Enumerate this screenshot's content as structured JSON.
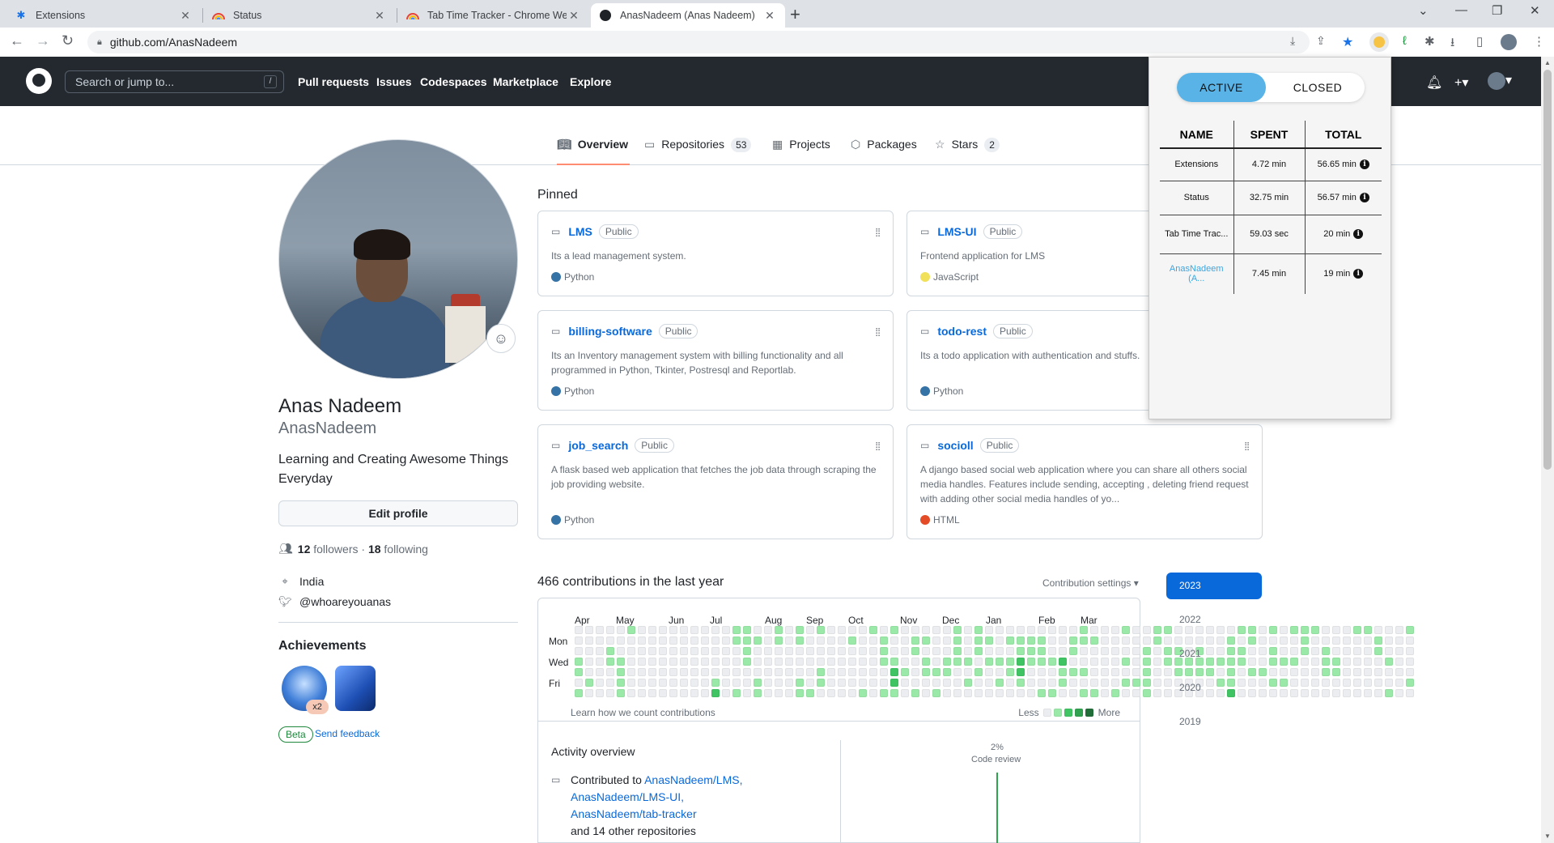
{
  "browser": {
    "tabs": [
      {
        "title": "Extensions",
        "icon": "puzzle-icon"
      },
      {
        "title": "Status",
        "icon": "rainbow-icon"
      },
      {
        "title": "Tab Time Tracker - Chrome Web",
        "icon": "rainbow-icon"
      },
      {
        "title": "AnasNadeem (Anas Nadeem)",
        "icon": "github-icon"
      }
    ],
    "url": "github.com/AnasNadeem"
  },
  "gh_header": {
    "search_placeholder": "Search or jump to...",
    "slash": "/",
    "nav": [
      "Pull requests",
      "Issues",
      "Codespaces",
      "Marketplace",
      "Explore"
    ]
  },
  "profile": {
    "name": "Anas Nadeem",
    "login": "AnasNadeem",
    "bio": "Learning and Creating Awesome Things Everyday",
    "edit_label": "Edit profile",
    "followers": "12",
    "followers_label": "followers",
    "dot": "·",
    "following": "18",
    "following_label": "following",
    "location": "India",
    "twitter": "@whoareyouanas",
    "achievements_title": "Achievements",
    "badge_count": "x2",
    "beta": "Beta",
    "feedback": "Send feedback"
  },
  "profile_tabs": [
    {
      "label": "Overview",
      "count": null
    },
    {
      "label": "Repositories",
      "count": "53"
    },
    {
      "label": "Projects",
      "count": null
    },
    {
      "label": "Packages",
      "count": null
    },
    {
      "label": "Stars",
      "count": "2"
    }
  ],
  "pinned": {
    "title": "Pinned",
    "public_label": "Public",
    "repos": [
      {
        "name": "LMS",
        "desc": "Its a lead management system.",
        "lang": "Python",
        "color": "#3572A5"
      },
      {
        "name": "LMS-UI",
        "desc": "Frontend application for LMS",
        "lang": "JavaScript",
        "color": "#f1e05a"
      },
      {
        "name": "billing-software",
        "desc": "Its an Inventory management system with billing functionality and all programmed in Python, Tkinter, Postresql and Reportlab.",
        "lang": "Python",
        "color": "#3572A5"
      },
      {
        "name": "todo-rest",
        "desc": "Its a todo application with authentication and stuffs.",
        "lang": "Python",
        "color": "#3572A5"
      },
      {
        "name": "job_search",
        "desc": "A flask based web application that fetches the job data through scraping the job providing website.",
        "lang": "Python",
        "color": "#3572A5"
      },
      {
        "name": "socioll",
        "desc": "A django based social web application where you can share all others social media handles. Features include sending, accepting , deleting friend request with adding other social media handles of yo...",
        "lang": "HTML",
        "color": "#e34c26"
      }
    ]
  },
  "contributions": {
    "title": "466 contributions in the last year",
    "settings": "Contribution settings ▾",
    "months": [
      "Apr",
      "May",
      "Jun",
      "Jul",
      "Aug",
      "Sep",
      "Oct",
      "Nov",
      "Dec",
      "Jan",
      "Feb",
      "Mar"
    ],
    "days": [
      "Mon",
      "Wed",
      "Fri"
    ],
    "learn": "Learn how we count contributions",
    "less": "Less",
    "more": "More",
    "levels": "0001101000001000000000011000000111110000000000000000000000000000000000000000000000000000000000001200000001100001111100001000110000000110000000000001100011000000110001100000000000000001000000000001100000001110011001221000010001100010101100000010100011001111000000101011101000101000000101001011000112210011100001110010001001000211001101001100101010000100000000000001100101000000100011111110000010110000011100000110000111000001100000101001111121011000110010000001001011010000101010010001110000100000000111000001100000000010000001000000011000000010010000000100001000010"
  },
  "activity": {
    "title": "Activity overview",
    "contributed_to": "Contributed to",
    "repos": [
      "AnasNadeem/LMS,",
      "AnasNadeem/LMS-UI,",
      "AnasNadeem/tab-tracker"
    ],
    "others": "and 14 other repositories",
    "cr_pct": "2%",
    "cr_label": "Code review"
  },
  "years": [
    "2023",
    "2022",
    "2021",
    "2020",
    "2019"
  ],
  "tracker": {
    "toggle_active": "ACTIVE",
    "toggle_closed": "CLOSED",
    "headers": [
      "NAME",
      "SPENT",
      "TOTAL"
    ],
    "rows": [
      {
        "name": "Extensions",
        "spent": "4.72 min",
        "total": "56.65 min"
      },
      {
        "name": "Status",
        "spent": "32.75 min",
        "total": "56.57 min"
      },
      {
        "name": "Tab Time Trac...",
        "spent": "59.03 sec",
        "total": "20 min"
      },
      {
        "name": "AnasNadeem (A...",
        "spent": "7.45 min",
        "total": "19 min"
      }
    ],
    "info_glyph": "i"
  },
  "colors": {
    "gh_header": "#24292f",
    "accent_blue": "#0969da",
    "tab_underline": "#fd8c73",
    "tracker_active": "#5ab3e6"
  }
}
